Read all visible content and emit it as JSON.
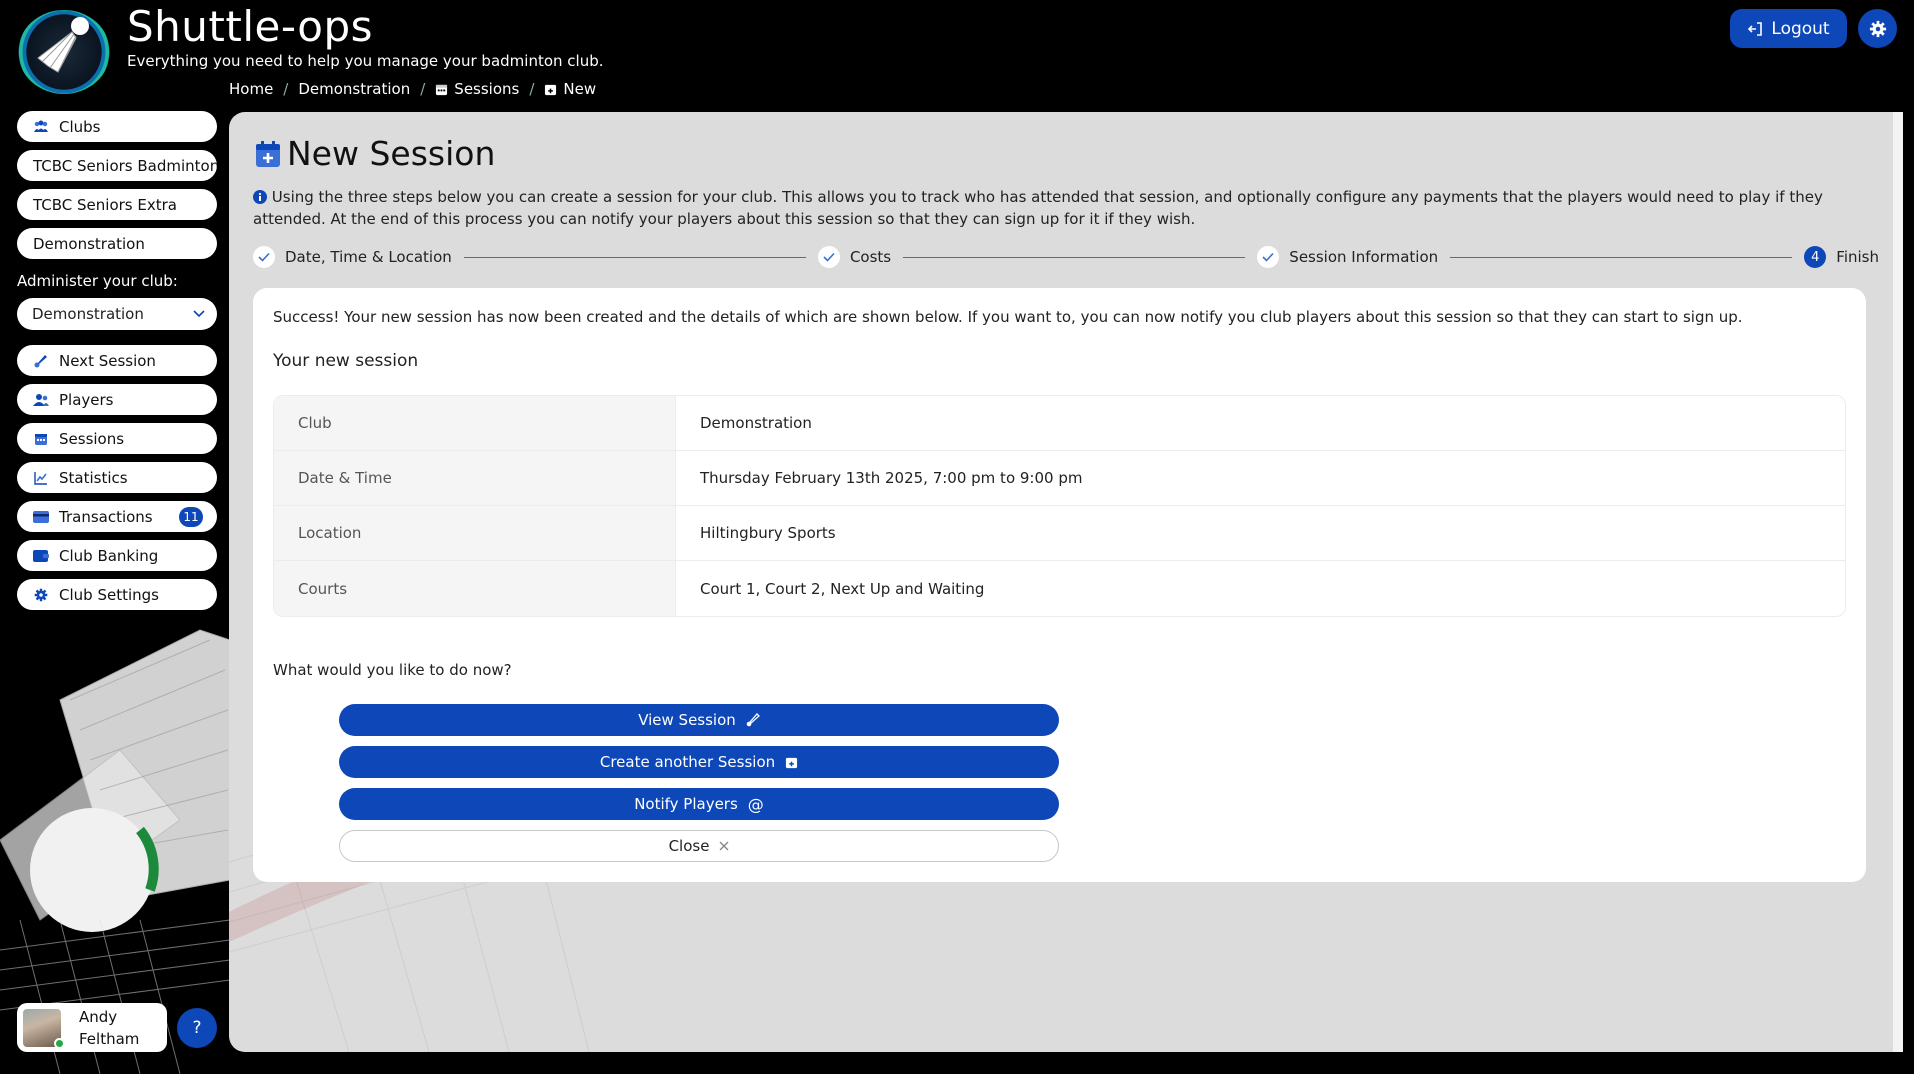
{
  "app": {
    "title": "Shuttle-ops",
    "tagline": "Everything you need to help you manage your badminton club."
  },
  "breadcrumb": [
    {
      "label": "Home"
    },
    {
      "label": "Demonstration"
    },
    {
      "label": "Sessions",
      "icon": "calendar-icon"
    },
    {
      "label": "New",
      "icon": "calendar-plus-icon"
    }
  ],
  "header": {
    "logout_label": "Logout",
    "settings_icon": "gear-icon"
  },
  "sidebar": {
    "clubs_label": "Clubs",
    "club_links": [
      "TCBC Seniors Badminton",
      "TCBC Seniors Extra",
      "Demonstration"
    ],
    "admin_label": "Administer your club:",
    "selected_club": "Demonstration",
    "nav": [
      {
        "label": "Next Session",
        "icon": "shuttlecock-icon"
      },
      {
        "label": "Players",
        "icon": "users-icon"
      },
      {
        "label": "Sessions",
        "icon": "calendar-icon"
      },
      {
        "label": "Statistics",
        "icon": "chart-line-icon"
      },
      {
        "label": "Transactions",
        "icon": "credit-card-icon",
        "badge": "11"
      },
      {
        "label": "Club Banking",
        "icon": "wallet-icon"
      },
      {
        "label": "Club Settings",
        "icon": "gear-icon"
      }
    ],
    "user": {
      "first": "Andy",
      "last": "Feltham",
      "status_color": "#27a844"
    },
    "help_label": "?"
  },
  "page": {
    "title": "New Session",
    "intro": "Using the three steps below you can create a session for your club. This allows you to track who has attended that session, and optionally configure any payments that the players would need to play if they attended. At the end of this process you can notify your players about this session so that they can sign up for it if they wish.",
    "steps": [
      {
        "label": "Date, Time & Location",
        "state": "done"
      },
      {
        "label": "Costs",
        "state": "done"
      },
      {
        "label": "Session Information",
        "state": "done"
      },
      {
        "label": "Finish",
        "number": "4",
        "state": "active"
      }
    ],
    "success_text": "Success! Your new session has now been created and the details of which are shown below. If you want to, you can now notify you club players about this session so that they can start to sign up.",
    "details_heading": "Your new session",
    "details": [
      {
        "label": "Club",
        "value": "Demonstration"
      },
      {
        "label": "Date & Time",
        "value": "Thursday February 13th 2025, 7:00 pm to 9:00 pm"
      },
      {
        "label": "Location",
        "value": "Hiltingbury Sports"
      },
      {
        "label": "Courts",
        "value": "Court 1, Court 2, Next Up and Waiting"
      }
    ],
    "question": "What would you like to do now?",
    "actions": {
      "view": "View Session",
      "create": "Create another Session",
      "notify": "Notify Players",
      "close": "Close"
    }
  },
  "colors": {
    "accent": "#0d47b8",
    "panel": "#dcdcdc",
    "background": "#000000"
  }
}
